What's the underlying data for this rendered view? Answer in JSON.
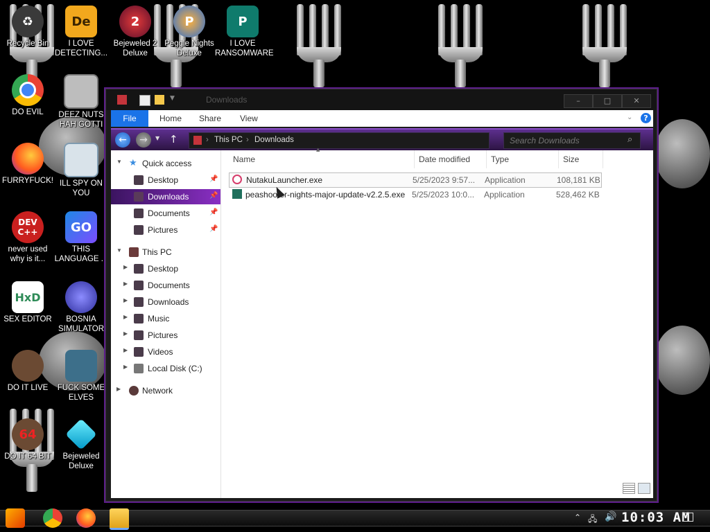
{
  "desktop": {
    "icons": [
      {
        "label": "Recycle Bin"
      },
      {
        "label": "I LOVE DETECTING..."
      },
      {
        "label": "Bejeweled 2 Deluxe"
      },
      {
        "label": "Peggle Nights Deluxe"
      },
      {
        "label": "I LOVE RANSOMWARE"
      },
      {
        "label": "DO EVIL"
      },
      {
        "label": "DEEZ NUTS HAH GOTTI"
      },
      {
        "label": "FURRYFUCK!"
      },
      {
        "label": "ILL SPY ON YOU"
      },
      {
        "label": "never used why is it..."
      },
      {
        "label": "THIS LANGUAGE ..."
      },
      {
        "label": "SEX EDITOR"
      },
      {
        "label": "BOSNIA SIMULATOR"
      },
      {
        "label": "DO IT LIVE"
      },
      {
        "label": "FUCK SOME ELVES"
      },
      {
        "label": "DO IT 64 BIT"
      },
      {
        "label": "Bejeweled Deluxe"
      }
    ]
  },
  "window": {
    "title": "Downloads",
    "ribbon_tabs": [
      "File",
      "Home",
      "Share",
      "View"
    ],
    "breadcrumb": [
      "This PC",
      "Downloads"
    ],
    "search_placeholder": "Search Downloads",
    "nav": {
      "quick_access": "Quick access",
      "quick_items": [
        "Desktop",
        "Downloads",
        "Documents",
        "Pictures"
      ],
      "this_pc": "This PC",
      "pc_items": [
        "Desktop",
        "Documents",
        "Downloads",
        "Music",
        "Pictures",
        "Videos",
        "Local Disk (C:)"
      ],
      "network": "Network"
    },
    "columns": [
      "Name",
      "Date modified",
      "Type",
      "Size"
    ],
    "files": [
      {
        "name": "NutakuLauncher.exe",
        "date": "5/25/2023 9:57...",
        "type": "Application",
        "size": "108,181 KB"
      },
      {
        "name": "peashooter-nights-major-update-v2.2.5.exe",
        "date": "5/25/2023 10:0...",
        "type": "Application",
        "size": "528,462 KB"
      }
    ]
  },
  "taskbar": {
    "clock": "10:03 AM"
  },
  "colors": {
    "accent": "#8a2fc4",
    "file_tab": "#1a73e8"
  }
}
